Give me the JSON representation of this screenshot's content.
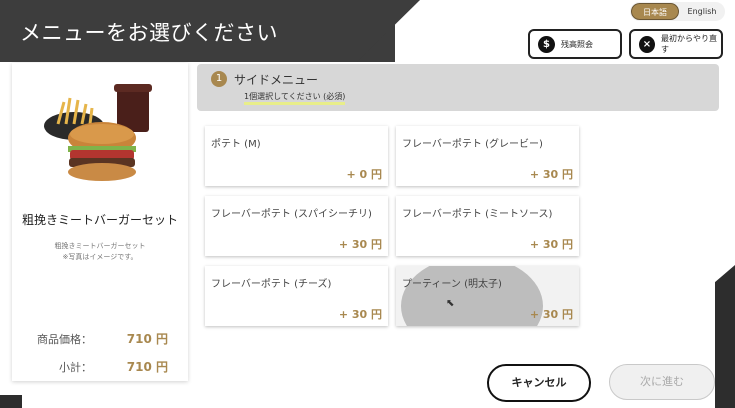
{
  "header": {
    "title": "メニューをお選びください",
    "languages": [
      {
        "label": "日本語",
        "active": true
      },
      {
        "label": "English",
        "active": false
      }
    ],
    "balance_button": {
      "label": "残高照会",
      "icon": "money-bag-icon"
    },
    "restart_button": {
      "label": "最初からやり直す",
      "icon": "close-icon"
    }
  },
  "product": {
    "name": "粗挽きミートバーガーセット",
    "note_line1": "粗挽きミートバーガーセット",
    "note_line2": "※写真はイメージです。",
    "price_label": "商品価格：",
    "price_value": "710 円",
    "subtotal_label": "小計：",
    "subtotal_value": "710 円"
  },
  "section": {
    "step": "1",
    "title": "サイドメニュー",
    "subtitle": "1個選択してください (必須)"
  },
  "options": [
    {
      "name": "ポテト (M)",
      "price": "+ 0 円"
    },
    {
      "name": "フレーバーポテト (グレービー)",
      "price": "+ 30 円"
    },
    {
      "name": "フレーバーポテト (スパイシーチリ)",
      "price": "+ 30 円"
    },
    {
      "name": "フレーバーポテト (ミートソース)",
      "price": "+ 30 円"
    },
    {
      "name": "フレーバーポテト (チーズ)",
      "price": "+ 30 円"
    },
    {
      "name": "プーティーン (明太子)",
      "price": "+ 30 円"
    }
  ],
  "footer": {
    "cancel_label": "キャンセル",
    "next_label": "次に進む"
  },
  "colors": {
    "accent": "#a8884f",
    "header_dark": "#3d3d3d",
    "section_bg": "#d7d7d7"
  }
}
